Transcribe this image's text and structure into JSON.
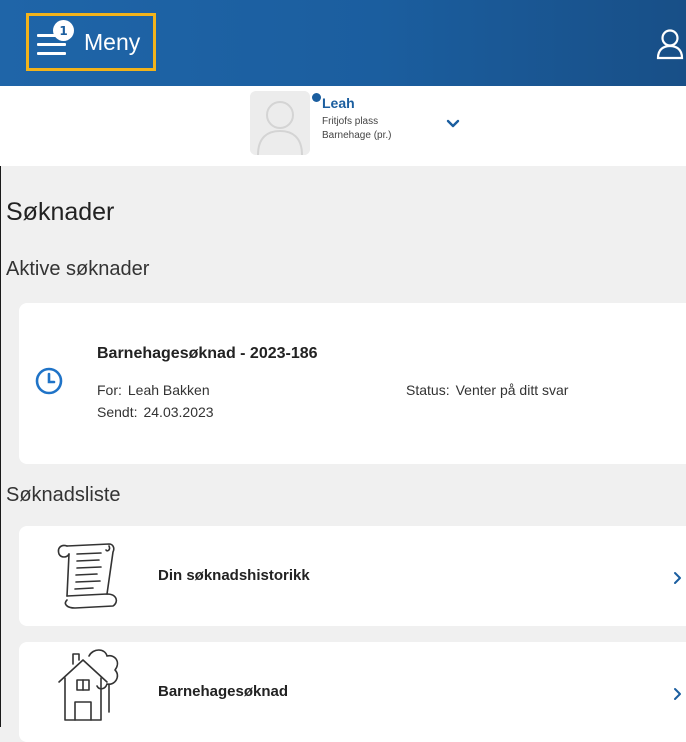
{
  "header": {
    "menu_label": "Meny",
    "menu_badge": "1",
    "accent_color": "#1b5e9f",
    "highlight_color": "#f2b31b"
  },
  "profile": {
    "name": "Leah",
    "line1": "Fritjofs plass",
    "line2": "Barnehage (pr.)"
  },
  "page": {
    "title": "Søknader",
    "active_section": "Aktive søknader",
    "list_section": "Søknadsliste"
  },
  "active_application": {
    "title": "Barnehagesøknad - 2023-186",
    "for_label": "For:",
    "for_value": "Leah Bakken",
    "sent_label": "Sendt:",
    "sent_value": "24.03.2023",
    "status_label": "Status:",
    "status_value": "Venter på ditt svar",
    "icon": "clock-icon"
  },
  "list_items": [
    {
      "label": "Din søknadshistorikk",
      "icon": "scroll-document-icon"
    },
    {
      "label": "Barnehagesøknad",
      "icon": "kindergarten-house-icon"
    }
  ]
}
